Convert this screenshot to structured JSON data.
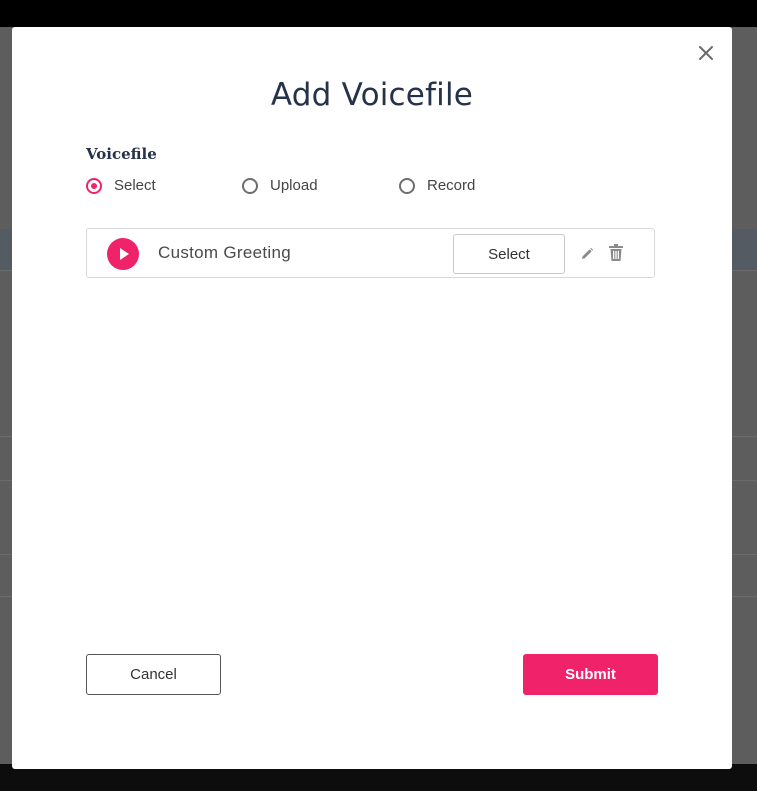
{
  "modal": {
    "title": "Add Voicefile",
    "close_icon": "close-icon"
  },
  "voicefile": {
    "label": "Voicefile",
    "options": [
      {
        "label": "Select",
        "checked": true
      },
      {
        "label": "Upload",
        "checked": false
      },
      {
        "label": "Record",
        "checked": false
      }
    ]
  },
  "files": [
    {
      "name": "Custom Greeting",
      "select_label": "Select",
      "icons": [
        "play-icon",
        "pencil-icon",
        "trash-icon"
      ]
    }
  ],
  "footer": {
    "cancel_label": "Cancel",
    "submit_label": "Submit"
  },
  "colors": {
    "accent": "#f0226a",
    "title": "#25324a"
  }
}
